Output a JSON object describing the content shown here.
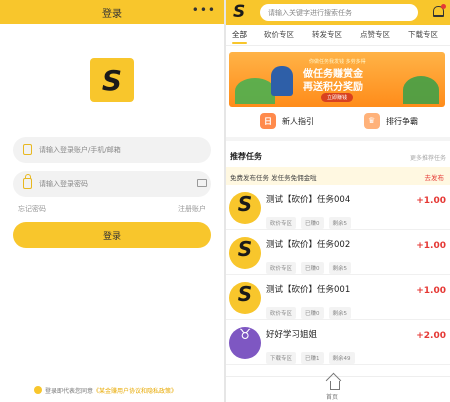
{
  "login": {
    "title": "登录",
    "more": "•••",
    "account_placeholder": "请输入登录账户/手机/邮箱",
    "password_placeholder": "请输入登录密码",
    "forgot": "忘记密码",
    "register": "注册账户",
    "submit": "登录",
    "agree_prefix": "登录即代表您同意",
    "agree_link": "《某金赚用户协议和隐私政策》"
  },
  "home": {
    "logo": "S",
    "search_placeholder": "请输入关键字进行搜索任务",
    "tabs": [
      "全部",
      "砍价专区",
      "转发专区",
      "点赞专区",
      "下载专区"
    ],
    "banner": {
      "small": "你做任务我发钱 多劳多得",
      "line1": "做任务赚赏金",
      "line2": "再送积分奖励",
      "button": "立即赚钱"
    },
    "quick": [
      {
        "label": "新人指引",
        "icon": "guide-icon"
      },
      {
        "label": "排行争霸",
        "icon": "rank-icon"
      }
    ],
    "section_title": "推荐任务",
    "section_more": "更多推荐任务",
    "notice_text": "免费发布任务 发任务免佣金啦",
    "notice_link": "去发布",
    "tasks": [
      {
        "title": "测试【砍价】任务004",
        "tags": [
          "砍价专区",
          "已赚0",
          "剩余5"
        ],
        "reward": "+1.00",
        "avatar": "S"
      },
      {
        "title": "测试【砍价】任务002",
        "tags": [
          "砍价专区",
          "已赚0",
          "剩余5"
        ],
        "reward": "+1.00",
        "avatar": "S"
      },
      {
        "title": "测试【砍价】任务001",
        "tags": [
          "砍价专区",
          "已赚0",
          "剩余5"
        ],
        "reward": "+1.00",
        "avatar": "S"
      },
      {
        "title": "好好学习姐姐",
        "tags": [
          "下载专区",
          "已赚1",
          "剩余49"
        ],
        "reward": "+2.00",
        "avatar": "♉"
      }
    ],
    "nav_home": "首页"
  },
  "colors": {
    "brand": "#f8c62c",
    "reward": "#e53935"
  }
}
